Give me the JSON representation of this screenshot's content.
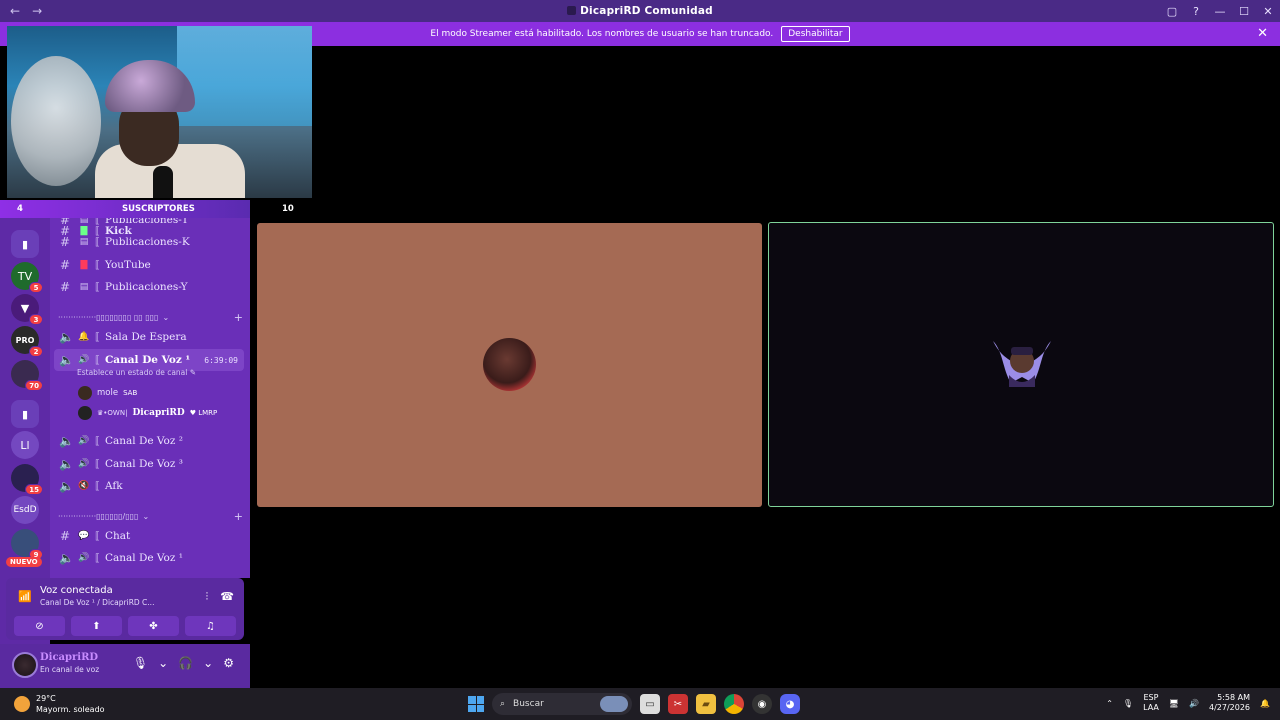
{
  "window": {
    "title": "DicapriRD Comunidad",
    "nav_back": "←",
    "nav_forward": "→",
    "controls": [
      "▢",
      "?",
      "—",
      "☐",
      "✕"
    ]
  },
  "banner": {
    "text": "El modo Streamer está habilitado. Los nombres de usuario se han truncado.",
    "button": "Deshabilitar",
    "close": "✕"
  },
  "overlay": {
    "count_left": "4",
    "label": "SUSCRIPTORES",
    "count_right": "10"
  },
  "servers": [
    {
      "label": "",
      "badge": ""
    },
    {
      "label": "TV",
      "badge": "5"
    },
    {
      "label": "▼",
      "badge": "3"
    },
    {
      "label": "PRO",
      "badge": "2"
    },
    {
      "label": "",
      "badge": "70"
    },
    {
      "label": "",
      "badge": ""
    },
    {
      "label": "Ll",
      "badge": ""
    },
    {
      "label": "",
      "badge": "15"
    },
    {
      "label": "EsdD",
      "badge": ""
    },
    {
      "label": "",
      "badge": "9"
    }
  ],
  "nuevo": "NUEVO",
  "channels": {
    "top_partial": "Publicaciones-T",
    "items": [
      {
        "name": "Kick"
      },
      {
        "name": "Publicaciones-K"
      },
      {
        "name": "YouTube"
      },
      {
        "name": "Publicaciones-Y"
      }
    ],
    "category1": "···············▯▯▯▯▯▯▯▯ ▯▯ ▯▯▯",
    "voice": [
      {
        "name": "Sala De Espera"
      },
      {
        "name": "Canal De Voz ¹",
        "timer": "6:39:09",
        "status": "Establece un estado de canal ✎"
      }
    ],
    "users": [
      {
        "name": "mole",
        "tag": "SAB"
      },
      {
        "name": "DicapriRD",
        "prefix": "♛•OWN|",
        "tag": "♥ LMRP"
      }
    ],
    "voice2": [
      {
        "name": "Canal De Voz ²"
      },
      {
        "name": "Canal De Voz ³"
      },
      {
        "name": "Afk"
      }
    ],
    "category2": "···············▯▯▯▯▯▯/▯▯▯",
    "text2": [
      {
        "name": "Chat"
      },
      {
        "name": "Canal De Voz ¹"
      }
    ]
  },
  "voice_panel": {
    "title": "Voz conectada",
    "sub": "Canal De Voz ¹ / DicapriRD C..."
  },
  "user_panel": {
    "name": "DicapriRD",
    "status": "En canal de voz"
  },
  "taskbar": {
    "temp": "29°C",
    "weather": "Mayorm. soleado",
    "search": "Buscar",
    "lang1": "ESP",
    "lang2": "LAA",
    "time": "5:58 AM",
    "date": "4/27/2026"
  }
}
